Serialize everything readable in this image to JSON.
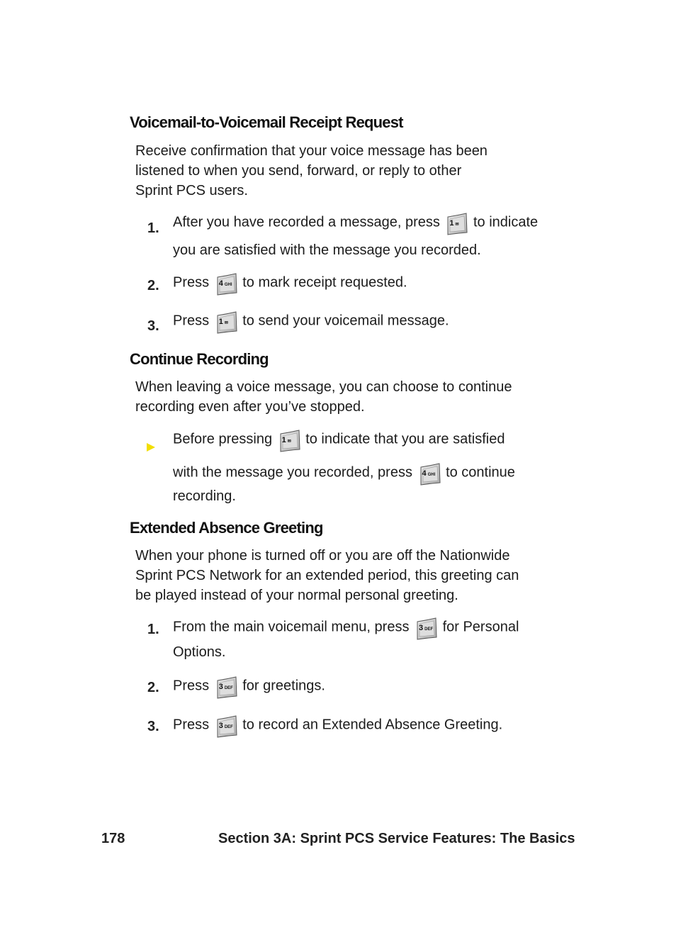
{
  "sections": [
    {
      "heading": "Voicemail-to-Voicemail Receipt Request",
      "intro_lines": [
        "Receive confirmation that your voice message has been",
        "listened to when you send, forward, or reply to other",
        "Sprint PCS users."
      ],
      "steps": [
        {
          "number": "1.",
          "before": "After you have recorded a message, press",
          "key": "1",
          "key_sub": "✉",
          "after": "to indicate",
          "line2": "you are satisfied with the message you recorded."
        },
        {
          "number": "2.",
          "before": "Press",
          "key": "4",
          "key_sub": "GHI",
          "after": "to mark receipt requested."
        },
        {
          "number": "3.",
          "before": "Press",
          "key": "1",
          "key_sub": "✉",
          "after": "to send your voicemail message."
        }
      ]
    },
    {
      "heading": "Continue Recording",
      "intro_lines": [
        "When leaving a voice message, you can choose to continue",
        "recording even after you’ve stopped."
      ],
      "tip": {
        "line1_before": "Before pressing",
        "key1": "1",
        "key1_sub": "✉",
        "line1_after": "to indicate that you are satisfied",
        "line2_before": "with the message you recorded, press",
        "key2": "4",
        "key2_sub": "GHI",
        "line2_after": "to continue",
        "line3": "recording."
      }
    },
    {
      "heading": "Extended Absence Greeting",
      "intro_lines": [
        "When your phone is turned off or you are off the Nationwide",
        "Sprint PCS Network for an extended period, this greeting can",
        "be played instead of your normal personal greeting."
      ],
      "steps": [
        {
          "number": "1.",
          "before": "From the main voicemail menu, press",
          "key": "3",
          "key_sub": "DEF",
          "after": "for Personal",
          "line2": "Options."
        },
        {
          "number": "2.",
          "before": "Press",
          "key": "3",
          "key_sub": "DEF",
          "after": "for greetings."
        },
        {
          "number": "3.",
          "before": "Press",
          "key": "3",
          "key_sub": "DEF",
          "after": "to record an Extended Absence Greeting."
        }
      ]
    }
  ],
  "footer": {
    "page_number": "178",
    "section_title": "Section 3A: Sprint PCS Service Features: The Basics"
  },
  "colors": {
    "bullet": "#f2de00",
    "key_fill": "#c8c8c8"
  }
}
